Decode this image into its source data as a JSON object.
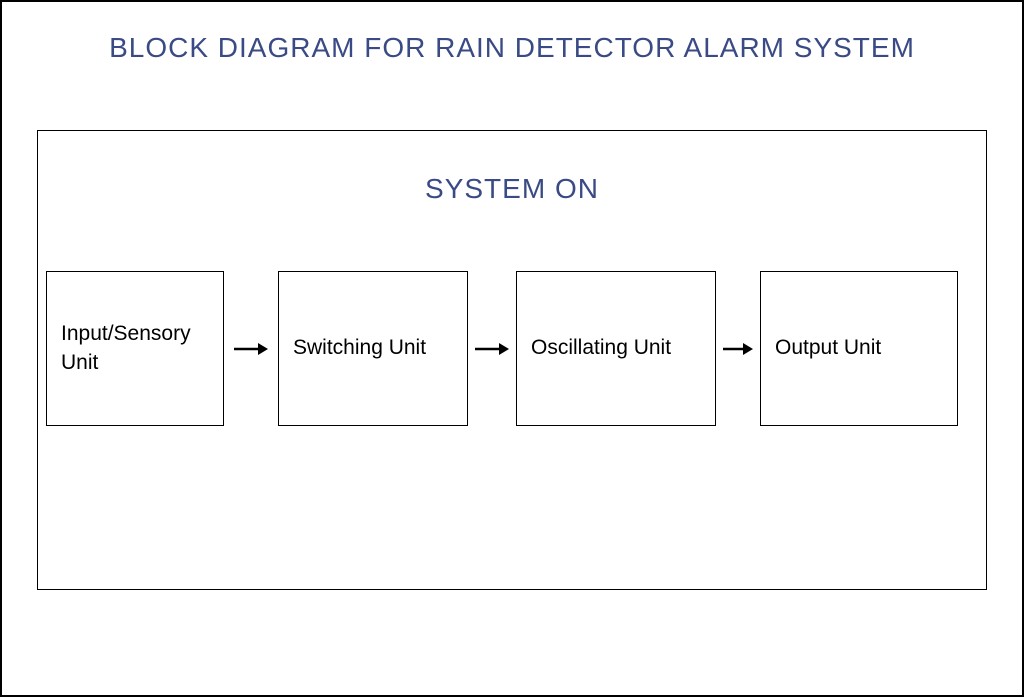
{
  "title": "BLOCK DIAGRAM FOR RAIN DETECTOR ALARM SYSTEM",
  "system_label": "SYSTEM ON",
  "blocks": {
    "b1": "Input/Sensory Unit",
    "b2": "Switching Unit",
    "b3": "Oscillating Unit",
    "b4": "Output Unit"
  }
}
